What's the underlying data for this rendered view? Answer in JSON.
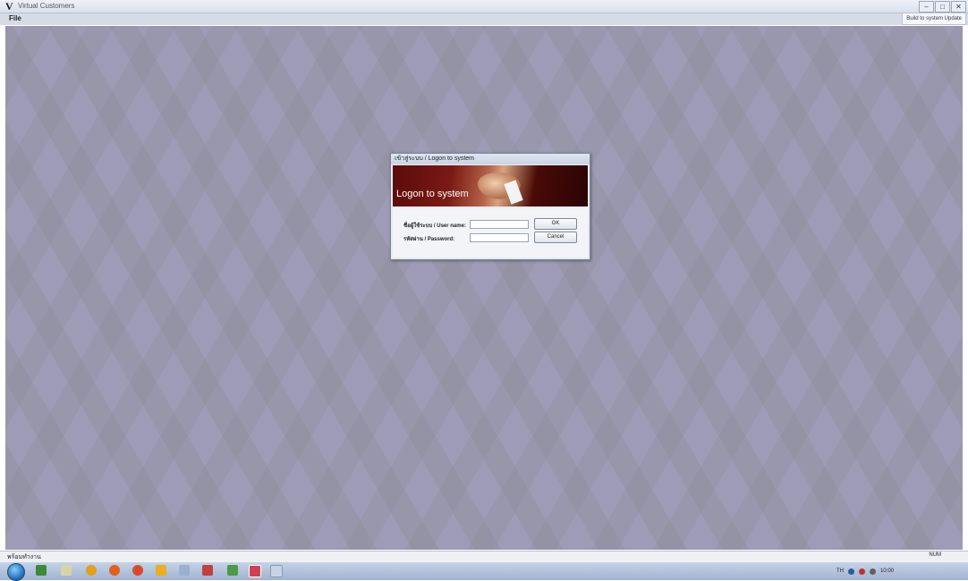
{
  "window": {
    "logo": "V",
    "title": "Virtual Customers",
    "controls": [
      "–",
      "□",
      "✕"
    ],
    "top_right_info": "Build to system Update"
  },
  "menu": {
    "file": "File"
  },
  "dialog": {
    "title": "เข้าสู่ระบบ / Logon to system",
    "banner_text": "Logon to system",
    "username_label": "ชื่อผู้ใช้ระบบ / User name:",
    "password_label": "รหัสผ่าน / Password:",
    "username_value": "",
    "password_value": "",
    "ok_label": "OK",
    "cancel_label": "Cancel"
  },
  "status": {
    "left_text": "พร้อมทำงาน",
    "right_text": "NUM"
  },
  "taskbar": {
    "icons": [
      "ie-icon",
      "explorer-icon",
      "media-icon",
      "chrome-icon",
      "firefox-icon",
      "app-icon",
      "app-icon",
      "app-icon",
      "app-icon",
      "app-icon"
    ],
    "tray_text": "TH",
    "clock": "10:00"
  }
}
